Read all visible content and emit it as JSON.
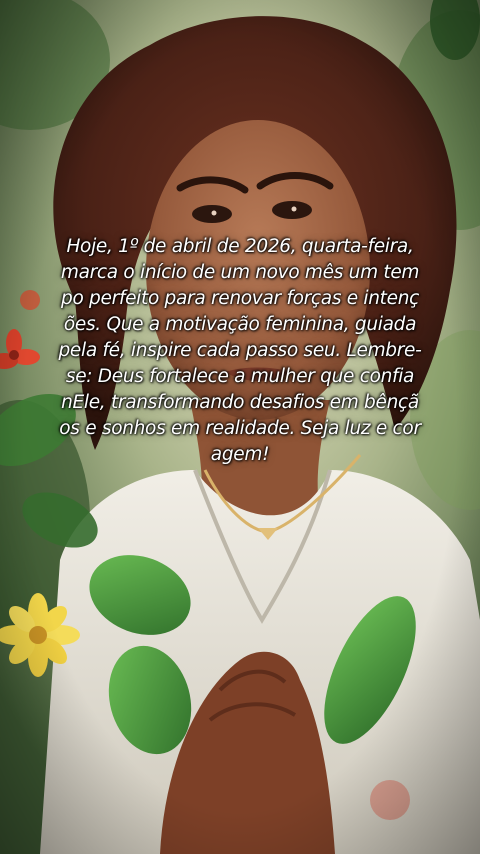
{
  "post": {
    "text": "Hoje, 1º de abril de 2026, quarta-feira,\nmarca o início de um novo mês um tem\npo perfeito para renovar forças e intenç\nões. Que a motivação feminina, guiada\npela fé, inspire cada passo seu. Lembre-\nse: Deus fortalece a mulher que confia\nnEle, transformando desafios em bênçã\nos e sonhos em realidade. Seja luz e cor\nagem!"
  },
  "colors": {
    "text": "#ffffff",
    "leaf_green": "#4f9a3f",
    "flower_yellow": "#f2d64a",
    "flower_red": "#d9402a",
    "dress_white": "#ece8df"
  }
}
